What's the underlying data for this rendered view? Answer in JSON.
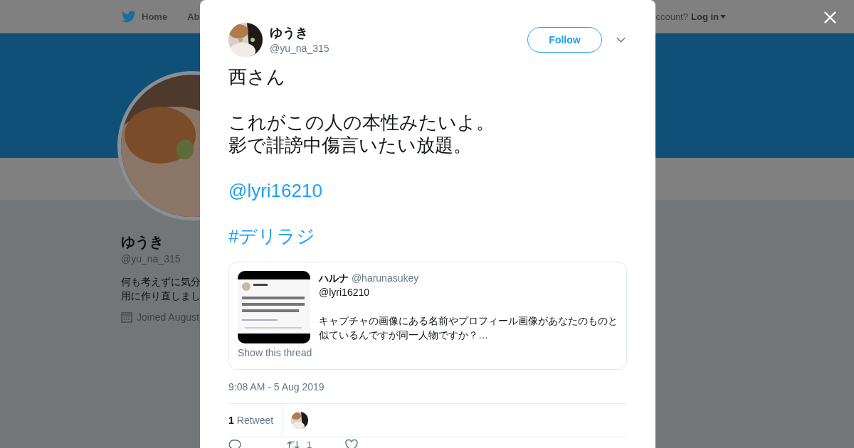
{
  "nav": {
    "items": [
      "Home",
      "Ab"
    ],
    "login_prompt": "ccount?",
    "login_link": "Log in"
  },
  "profile": {
    "name": "ゆうき",
    "handle": "@yu_na_315",
    "bio_lines": [
      "何も考えずに気分",
      "用に作り直しまし"
    ],
    "joined": "Joined August"
  },
  "tweet": {
    "author": {
      "name": "ゆうき",
      "handle": "@yu_na_315"
    },
    "follow_button": "Follow",
    "paragraphs": [
      {
        "kind": "text",
        "lines": [
          "西さん"
        ]
      },
      {
        "kind": "text",
        "lines": [
          "これがこの人の本性みたいよ。",
          "影で誹謗中傷言いたい放題。"
        ]
      },
      {
        "kind": "mention",
        "lines": [
          "@lyri16210"
        ]
      },
      {
        "kind": "hashtag",
        "lines": [
          "#デリラジ"
        ]
      }
    ],
    "quote": {
      "name": "ハルナ",
      "handle": "@harunasukey",
      "mention": "@lyri16210",
      "lines": [
        "キャプチャの画像にある名前やプロフィール画像があなたのものと",
        "似ているんですが同一人物ですか？…"
      ],
      "thread_link": "Show this thread"
    },
    "timestamp": "9:08 AM - 5 Aug 2019",
    "retweets": {
      "count": "1",
      "label": "Retweet"
    },
    "actions": [
      {
        "kind": "reply"
      },
      {
        "kind": "retweet",
        "count": "1"
      },
      {
        "kind": "like"
      }
    ]
  }
}
